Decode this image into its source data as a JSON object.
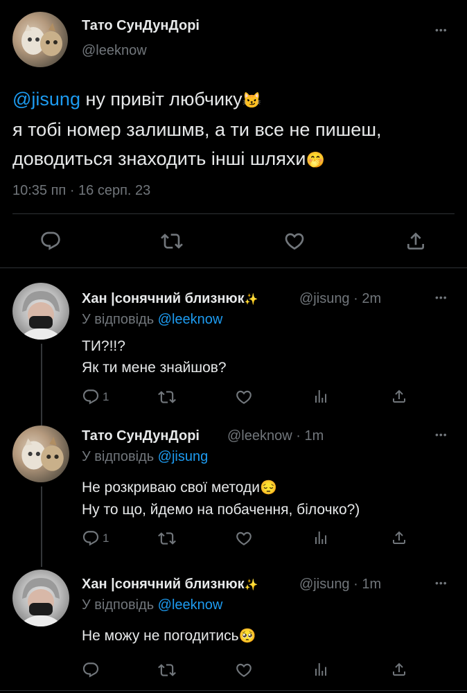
{
  "main_tweet": {
    "display_name": "Тато СунДунДорі",
    "handle": "@leeknow",
    "mention": "@jisung",
    "line1": " ну привіт любчику",
    "emoji1": "😼",
    "line2": "я тобі номер залишмв, а ти все не пишеш,",
    "line3": "доводиться знаходить інші шляхи",
    "emoji2": "🤭",
    "timestamp": "10:35 пп · 16 серп. 23",
    "more": "•••"
  },
  "replies": [
    {
      "display_name": "Хан |сонячний близнюк",
      "sparkle": "✨",
      "handle": "@jisung",
      "time": "· 2m",
      "reply_prefix": "У відповідь ",
      "reply_to": "@leeknow",
      "text_line1": "ТИ?!!?",
      "text_line2": "Як ти мене знайшов?",
      "reply_count": "1",
      "more": "•••"
    },
    {
      "display_name": "Тато СунДунДорі",
      "handle": "@leeknow",
      "time": "· 1m",
      "reply_prefix": "У відповідь ",
      "reply_to": "@jisung",
      "text_line1": "Не розкриваю свої методи",
      "emoji1": "😔",
      "text_line2": "Ну то що, йдемо на побачення, білочко?)",
      "reply_count": "1",
      "more": "•••"
    },
    {
      "display_name": "Хан |сонячний близнюк",
      "sparkle": "✨",
      "handle": "@jisung",
      "time": "· 1m",
      "reply_prefix": "У відповідь ",
      "reply_to": "@leeknow",
      "text_line1": "Не можу не погодитись",
      "emoji1": "🥺",
      "more": "•••"
    }
  ],
  "colors": {
    "background": "#000000",
    "text": "#e7e9ea",
    "secondary": "#71767b",
    "accent": "#1d9bf0",
    "divider": "#2f3336"
  }
}
